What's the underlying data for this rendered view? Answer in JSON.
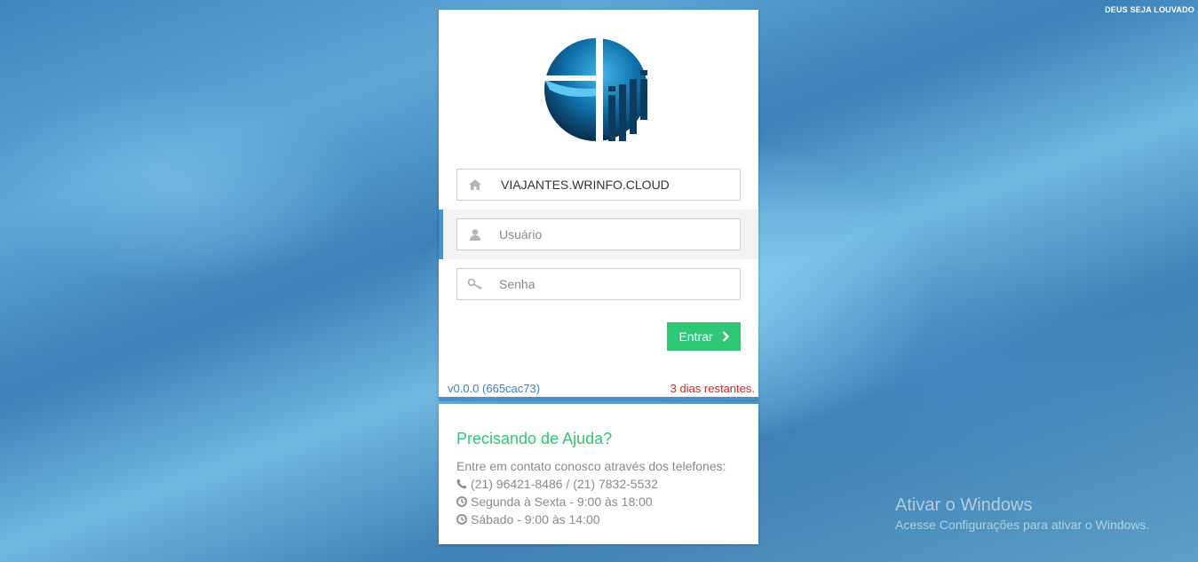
{
  "header": {
    "note": "DEUS SEJA LOUVADO"
  },
  "login": {
    "logo_name": "company-logo",
    "domain_value": "VIAJANTES.WRINFO.CLOUD",
    "username_placeholder": "Usuário",
    "password_placeholder": "Senha",
    "submit_label": "Entrar",
    "version": "v0.0.0 (665cac73)",
    "days_left": "3 dias restantes."
  },
  "help": {
    "title": "Precisando de Ajuda?",
    "intro": "Entre em contato conosco através dos telefones:",
    "phones": "(21) 96421-8486 / (21) 7832-5532",
    "hours_weekdays": "Segunda à Sexta - 9:00 às 18:00",
    "hours_saturday": "Sábado - 9:00 às 14:00"
  },
  "watermark": {
    "title": "Ativar o Windows",
    "subtitle": "Acesse Configurações para ativar o Windows."
  },
  "colors": {
    "accent_blue": "#4a90c6",
    "button_green": "#2ec776",
    "warning_red": "#d9251d"
  }
}
